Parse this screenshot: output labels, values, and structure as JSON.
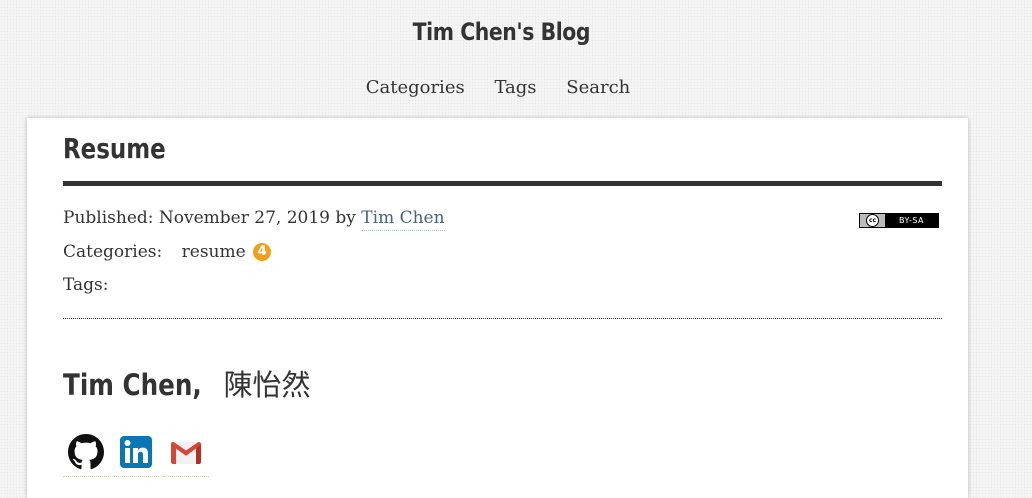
{
  "site": {
    "title": "Tim Chen's Blog"
  },
  "nav": {
    "items": [
      "Categories",
      "Tags",
      "Search"
    ]
  },
  "post": {
    "title": "Resume",
    "published_label": "Published:",
    "published_date": "November 27, 2019",
    "by_label": "by",
    "author": "Tim Chen",
    "categories_label": "Categories:",
    "category": "resume",
    "category_count": "4",
    "tags_label": "Tags:",
    "license_text": "BY-SA",
    "license_cc": "cc"
  },
  "content": {
    "name": "Tim Chen,",
    "chinese_name": "陳怡然",
    "social_icons": [
      "github-icon",
      "linkedin-icon",
      "gmail-icon"
    ]
  },
  "colors": {
    "badge": "#f0a01c",
    "author_link": "#4a6474",
    "linkedin": "#0a77b5",
    "gmail_red": "#d44638"
  }
}
